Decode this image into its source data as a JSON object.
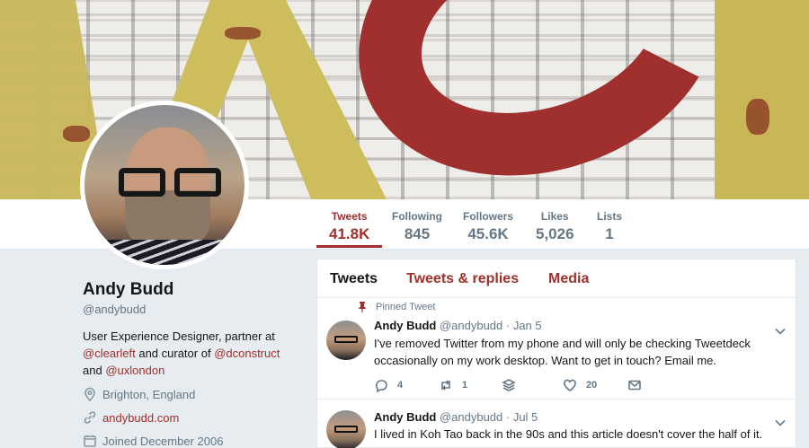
{
  "profile": {
    "name": "Andy Budd",
    "handle": "@andybudd",
    "bio_prefix": "User Experience Designer, partner at",
    "bio_link1": "@clearleft",
    "bio_mid": "and curator of",
    "bio_link2": "@dconstruct",
    "bio_and": "and",
    "bio_link3": "@uxlondon",
    "location": "Brighton, England",
    "website": "andybudd.com",
    "joined": "Joined December 2006"
  },
  "stats": [
    {
      "label": "Tweets",
      "value": "41.8K"
    },
    {
      "label": "Following",
      "value": "845"
    },
    {
      "label": "Followers",
      "value": "45.6K"
    },
    {
      "label": "Likes",
      "value": "5,026"
    },
    {
      "label": "Lists",
      "value": "1"
    }
  ],
  "tabs": [
    "Tweets",
    "Tweets & replies",
    "Media"
  ],
  "tweets": [
    {
      "pinned_label": "Pinned Tweet",
      "name": "Andy Budd",
      "handle": "@andybudd",
      "date": "· Jan 5",
      "text": "I've removed Twitter from my phone and will only be checking Tweetdeck occasionally on my work desktop. Want to get in touch? Email me.",
      "replies": "4",
      "retweets": "1",
      "likes": "20"
    },
    {
      "name": "Andy Budd",
      "handle": "@andybudd",
      "date": "· Jul 5",
      "text": "I lived in Koh Tao back in the 90s and this article doesn't cover the half of it."
    }
  ],
  "colors": {
    "accent": "#a0302d",
    "muted": "#657786",
    "background": "#e6ecf0"
  }
}
